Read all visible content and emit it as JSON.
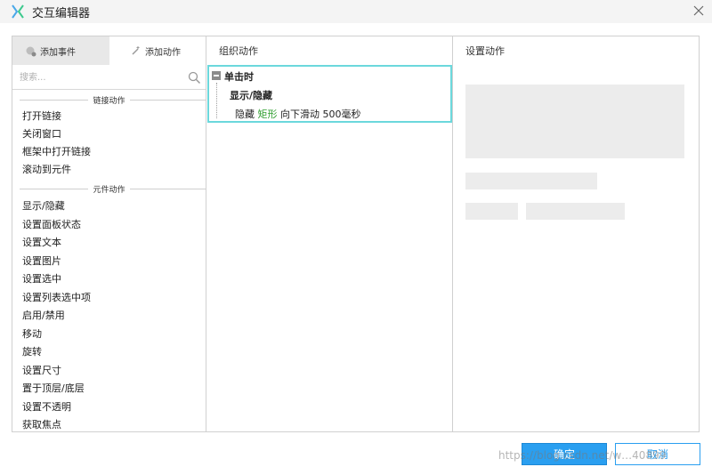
{
  "window": {
    "title": "交互编辑器",
    "logo_icon": "axure-x-logo",
    "close_icon": "close-icon"
  },
  "left_panel": {
    "tabs": [
      {
        "label": "添加事件",
        "icon": "add-event-icon",
        "active": true
      },
      {
        "label": "添加动作",
        "icon": "add-action-icon",
        "active": false
      }
    ],
    "search": {
      "placeholder": "搜索...",
      "value": ""
    },
    "link_section": {
      "header": "链接动作",
      "items": [
        "打开链接",
        "关闭窗口",
        "框架中打开链接",
        "滚动到元件"
      ]
    },
    "widget_section": {
      "header": "元件动作",
      "items": [
        "显示/隐藏",
        "设置面板状态",
        "设置文本",
        "设置图片",
        "设置选中",
        "设置列表选中项",
        "启用/禁用",
        "移动",
        "旋转",
        "设置尺寸",
        "置于顶层/底层",
        "设置不透明",
        "获取焦点"
      ]
    }
  },
  "middle_panel": {
    "header": "组织动作",
    "event": {
      "label": "单击时",
      "case_label": "显示/隐藏",
      "action": {
        "verb": "隐藏",
        "target": "矩形",
        "detail": "向下滑动 500毫秒"
      }
    }
  },
  "right_panel": {
    "header": "设置动作"
  },
  "buttons": {
    "ok": "确定",
    "cancel": "取消"
  },
  "watermark": "https://blog.csdn.net/w…40899",
  "colors": {
    "accent": "#2a9ff0",
    "highlight_border": "#6bd8dc",
    "target_text": "#2e9e2e"
  }
}
